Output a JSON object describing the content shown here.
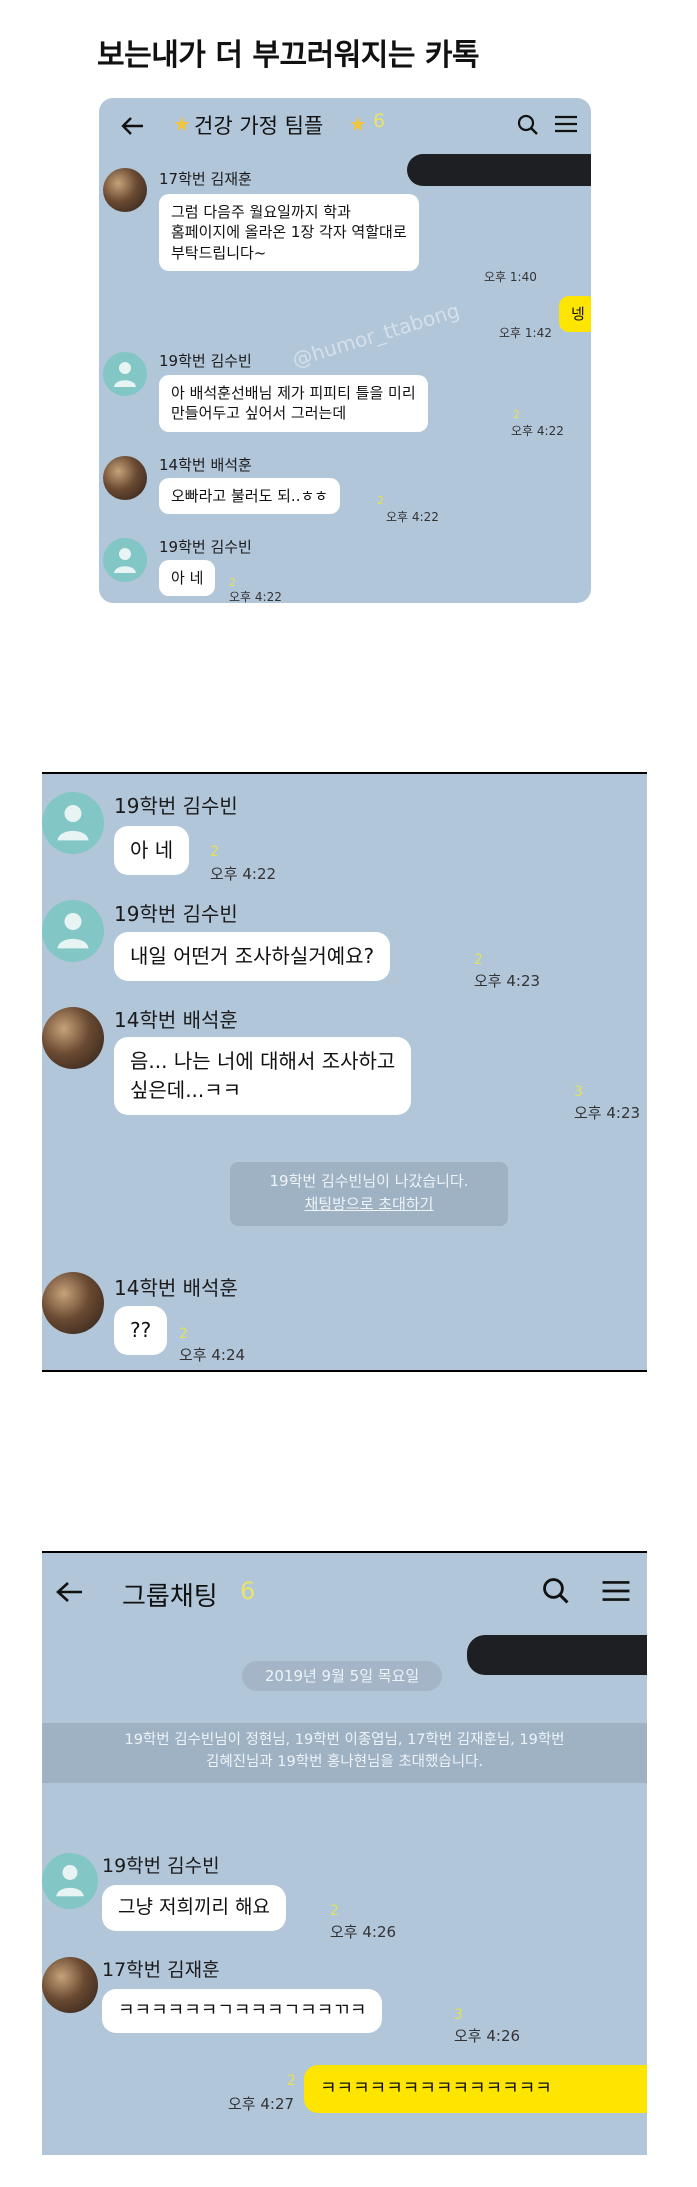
{
  "page_title": "보는내가 더 부끄러워지는 카톡",
  "watermark": "@humor_ttabong",
  "colors": {
    "chat_bg": "#b2c6d9",
    "my_bubble": "#fee500",
    "unread": "#e3e15a"
  },
  "panel1": {
    "header": {
      "title": "건강 가정 팀플",
      "count": "6"
    },
    "messages": [
      {
        "sender": "17학번 김재훈",
        "lines": [
          "그럼 다음주 월요일까지 학과",
          "홈페이지에 올라온 1장 각자 역할대로",
          "부탁드립니다~"
        ],
        "time": "오후 1:40"
      },
      {
        "sender": "me",
        "text": "넹",
        "time": "오후 1:42"
      },
      {
        "sender": "19학번 김수빈",
        "lines": [
          "아 배석훈선배님 제가 피피티 틀을 미리",
          "만들어두고 싶어서 그러는데"
        ],
        "unread": "2",
        "time": "오후 4:22"
      },
      {
        "sender": "14학번 배석훈",
        "text": "오빠라고 불러도 되..ㅎㅎ",
        "unread": "2",
        "time": "오후 4:22"
      },
      {
        "sender": "19학번 김수빈",
        "text": "아 네",
        "unread": "2",
        "time": "오후 4:22"
      }
    ]
  },
  "panel2": {
    "messages": [
      {
        "sender": "19학번 김수빈",
        "text": "아 네",
        "unread": "2",
        "time": "오후 4:22"
      },
      {
        "sender": "19학번 김수빈",
        "text": "내일 어떤거 조사하실거예요?",
        "unread": "2",
        "time": "오후 4:23"
      },
      {
        "sender": "14학번 배석훈",
        "lines": [
          "음... 나는 너에 대해서 조사하고",
          "싶은데...ㅋㅋ"
        ],
        "unread": "3",
        "time": "오후 4:23"
      },
      {
        "sender": "14학번 배석훈",
        "text": "??",
        "unread": "2",
        "time": "오후 4:24"
      }
    ],
    "notice": {
      "text": "19학번 김수빈님이 나갔습니다.",
      "link": "채팅방으로 초대하기"
    }
  },
  "panel3": {
    "header": {
      "title": "그룹채팅",
      "count": "6"
    },
    "date": "2019년 9월 5일 목요일",
    "invite": {
      "line1": "19학번 김수빈님이 정현님, 19학번 이종엽님, 17학번 김재훈님, 19학번",
      "line2": "김혜진님과 19학번 홍나현님을 초대했습니다."
    },
    "messages": [
      {
        "sender": "19학번 김수빈",
        "text": "그냥 저희끼리 해요",
        "unread": "2",
        "time": "오후 4:26"
      },
      {
        "sender": "17학번 김재훈",
        "text": "ㅋㅋㅋㅋㅋㅋㄱㅋㅋㅋㄱㅋㅋㄲㅋ",
        "unread": "3",
        "time": "오후 4:26"
      },
      {
        "sender": "me",
        "text": "ㅋㅋㅋㅋㅋㅋㅋㅋㅋㅋㅋㅋㅋㅋ",
        "unread": "2",
        "time": "오후 4:27"
      }
    ]
  }
}
